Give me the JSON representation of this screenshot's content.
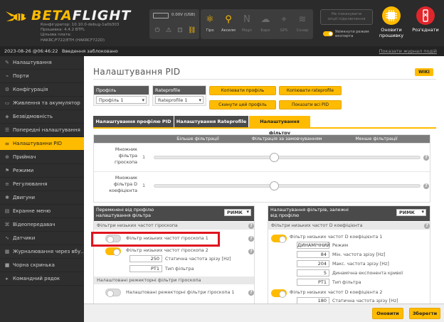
{
  "app": {
    "logo_prefix": "BETA",
    "logo_suffix": "FLIGHT",
    "fw_info": [
      "Конфігуратор: 10.10.0-debug-1a0b303",
      "Прошивка: 4.4.2 BTFL",
      "Цільова плата:",
      "HAKRC/F722/ETH (HAKRCF722D)"
    ],
    "battery": "0.00V (USB)",
    "sensors": [
      {
        "name": "Гіро",
        "icon": "gyro-icon",
        "glyph": "⚛",
        "on": true
      },
      {
        "name": "Акселм",
        "icon": "accel-icon",
        "glyph": "⚲",
        "on": true
      },
      {
        "name": "Magn",
        "icon": "mag-icon",
        "glyph": "N",
        "on": false
      },
      {
        "name": "Барo",
        "icon": "baro-icon",
        "glyph": "☁",
        "on": false
      },
      {
        "name": "GPS",
        "icon": "gps-icon",
        "glyph": "⌖",
        "on": false
      },
      {
        "name": "Сонар",
        "icon": "sonar-icon",
        "glyph": "≋",
        "on": false
      }
    ],
    "hide_button": "Не показувати\nопції підключення",
    "expert_label": "Увімкнути режим\nексперта",
    "update_button": "Оновити\nпрошивку",
    "disconnect_button": "Роз'єднати",
    "status_date": "2023-08-26 @06:46:22",
    "status_text": "Введення заблоковано",
    "status_right": "Показати журнал подій",
    "colors": {
      "accent": "#ffbb00",
      "danger": "#e0262b"
    }
  },
  "sidebar": {
    "items": [
      {
        "label": "Налаштування",
        "icon": "wrench-icon",
        "glyph": "✎"
      },
      {
        "label": "Порти",
        "icon": "plug-icon",
        "glyph": "⌁"
      },
      {
        "label": "Конфігурація",
        "icon": "gear-icon",
        "glyph": "⚙"
      },
      {
        "label": "Живлення та акумулятор",
        "icon": "battery-icon",
        "glyph": "▭"
      },
      {
        "label": "Безвідмовність",
        "icon": "shield-icon",
        "glyph": "◈"
      },
      {
        "label": "Попередні налаштування",
        "icon": "presets-icon",
        "glyph": "☰"
      },
      {
        "label": "Налаштуванни PID",
        "icon": "pid-icon",
        "glyph": "⚌",
        "active": true
      },
      {
        "label": "Приймач",
        "icon": "receiver-icon",
        "glyph": "⊕"
      },
      {
        "label": "Режими",
        "icon": "modes-icon",
        "glyph": "⚑"
      },
      {
        "label": "Регулювання",
        "icon": "adjust-icon",
        "glyph": "≡"
      },
      {
        "label": "Двигуни",
        "icon": "motor-icon",
        "glyph": "✱"
      },
      {
        "label": "Екранне меню",
        "icon": "osd-icon",
        "glyph": "▤"
      },
      {
        "label": "Відеопередавач",
        "icon": "vtx-icon",
        "glyph": "⌘"
      },
      {
        "label": "Датчики",
        "icon": "sensors-icon",
        "glyph": "∿"
      },
      {
        "label": "Журналювання через вбу...",
        "icon": "log-icon",
        "glyph": "▦"
      },
      {
        "label": "Чорна скринька",
        "icon": "blackbox-icon",
        "glyph": "■"
      },
      {
        "label": "Командний рядок",
        "icon": "cli-icon",
        "glyph": "▸"
      }
    ]
  },
  "main": {
    "title": "Налаштування PID",
    "wiki": "WIKI",
    "profile": {
      "header": "Профіль",
      "value": "Профіль 1"
    },
    "rateprofile": {
      "header": "Rateprofile",
      "value": "Rateprofile 1"
    },
    "buttons": {
      "copy_profile": "Копіювати профіль",
      "copy_rateprofile": "Копіювати rateprofile",
      "reset_profile": "Скинути цей профіль",
      "show_all_pids": "Показати всі PID"
    },
    "tabs": [
      {
        "label": "Налаштування профілю PID",
        "active": false
      },
      {
        "label": "Налаштування Rateprofile",
        "active": false
      },
      {
        "label": "Налаштування фільтру",
        "active": true
      }
    ],
    "slider_header": [
      "Більше фільтрації",
      "Фільтрація за замовчуванням",
      "Менше фільтрації"
    ],
    "sliders": [
      {
        "label": "Множник фільтра гіроскопа",
        "value": "1",
        "level": 0.5
      },
      {
        "label": "Множник фільтра D коефіцієнта",
        "value": "1",
        "level": 0.5
      }
    ],
    "left_panel": {
      "header": "Перемкнені від профілю\nналаштування фільтра",
      "mode": "РИМК",
      "sub1": "Фільтри низьких частот гіроскопа",
      "lpf1_label": "Фільтр низьких частот гіроскопа 1",
      "lpf2_label": "Фільтр низьких частот гіроскопа 2",
      "cutoff_label": "Статична частота зрізу [Hz]",
      "cutoff_value": "250",
      "type_label": "Тип фільтра",
      "type_value": "PT1",
      "sub2": "Налаштовані режекторні фільтри гіроскопа",
      "notch_label": "Налаштовані режекторні фільтри гіроскопа 1"
    },
    "right_panel": {
      "header": "Налаштування фільтрів, залежні\nвід профілю",
      "mode": "РИМК",
      "sub1": "Фільтри низьких частот D коефіцієнта",
      "dyn_label": "Фільтр низьких частот D коефіцієнта 1",
      "mode_label": "Режим",
      "mode_value": "ДИНАМІЧНИЙ",
      "min_label": "Мін. частота зрізу [Hz]",
      "min_value": "84",
      "max_label": "Макс. частота зрізу [Hz]",
      "max_value": "204",
      "expo_label": "Динамічна експонента кривої",
      "expo_value": "5",
      "type_label": "Тип фільтра",
      "type_value": "PT1",
      "lpf2_label": "Фільтр низьких частот D коефіцієнта 2",
      "static_label": "Статична частота зрізу [Hz]",
      "static_value": "180"
    },
    "save_button": "Зберегти",
    "refresh_button": "Оновити"
  }
}
